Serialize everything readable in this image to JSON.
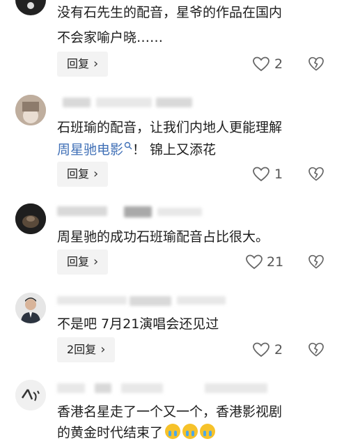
{
  "comments": [
    {
      "text_lines": [
        "没有石先生的配音，星爷的作品在国内",
        "不会家喻户晓……"
      ],
      "reply_label": "回复",
      "likes": "2"
    },
    {
      "text_prefix": "石班瑜的配音，让我们内地人更能理解",
      "link_text": "周星驰电影",
      "text_suffix": "！ 锦上又添花",
      "reply_label": "回复",
      "likes": "1"
    },
    {
      "text_lines": [
        "周星驰的成功石班瑜配音占比很大。"
      ],
      "reply_label": "回复",
      "likes": "21"
    },
    {
      "text_lines": [
        "不是吧 7月21演唱会还见过"
      ],
      "reply_label": "2回复",
      "likes": "2"
    },
    {
      "text_lines": [
        "香港名星走了一个又一个，香港影视剧",
        "的黄金时代结束了"
      ],
      "emojis": [
        "crying-face",
        "crying-face",
        "crying-face"
      ]
    }
  ],
  "icons": {
    "like": "heart-outline-icon",
    "dislike": "broken-heart-outline-icon",
    "search": "search-icon"
  },
  "colors": {
    "link": "#3f6fb6",
    "reply_bg": "#f3f3f3"
  }
}
